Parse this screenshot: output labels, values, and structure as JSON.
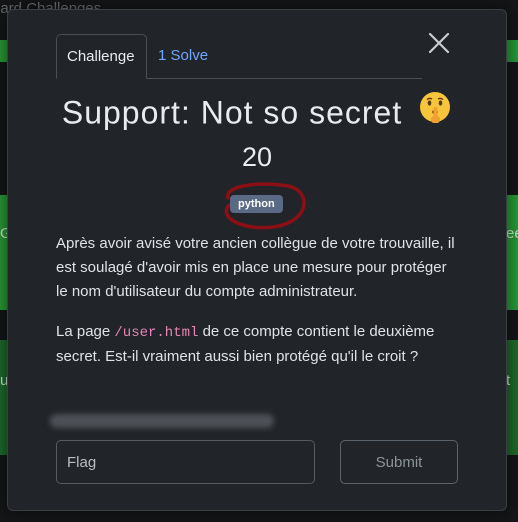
{
  "background": {
    "breadcrumb": "oard   Challenges",
    "side_left_letter_1": "G",
    "side_left_letter_2": "u",
    "side_right_text_1": "ee",
    "side_right_text_2": "t"
  },
  "tabs": [
    {
      "label": "Challenge"
    },
    {
      "label": "1 Solve"
    }
  ],
  "challenge": {
    "title": "Support: Not so secret",
    "title_emoji": "shushing-face-icon",
    "value": "20",
    "tag": "python",
    "description_1": "Après avoir avisé votre ancien collègue de votre trouvaille, il est soulagé d'avoir mis en place une mesure pour protéger le nom d'utilisateur du compte administrateur.",
    "description_2_prefix": "La page ",
    "description_2_code": "/user.html",
    "description_2_suffix": " de ce compte contient le deuxième secret. Est-il vraiment aussi bien protégé qu'il le croit ?"
  },
  "form": {
    "flag_placeholder": "Flag",
    "flag_value": "",
    "submit_label": "Submit"
  },
  "colors": {
    "modal_bg": "#212529",
    "accent_link": "#6ea8fe",
    "tag_bg": "#5a6a85",
    "annotation_red": "#8b0f14",
    "code_pink": "#e685b5"
  }
}
